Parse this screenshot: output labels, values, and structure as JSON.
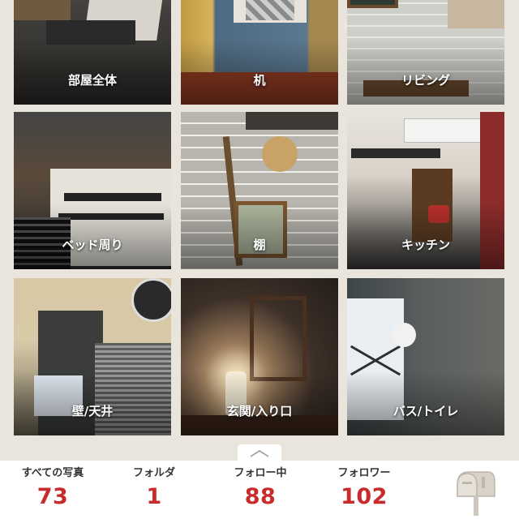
{
  "folders": [
    {
      "label": "部屋全体",
      "icon": "room-photo"
    },
    {
      "label": "机",
      "icon": "desk-photo"
    },
    {
      "label": "リビング",
      "icon": "living-photo"
    },
    {
      "label": "ベッド周り",
      "icon": "bed-photo"
    },
    {
      "label": "棚",
      "icon": "shelf-photo"
    },
    {
      "label": "キッチン",
      "icon": "kitchen-photo"
    },
    {
      "label": "壁/天井",
      "icon": "wall-photo"
    },
    {
      "label": "玄関/入り口",
      "icon": "entrance-photo"
    },
    {
      "label": "バス/トイレ",
      "icon": "bath-photo"
    }
  ],
  "stats": {
    "photos": {
      "label": "すべての写真",
      "value": "73"
    },
    "folders": {
      "label": "フォルダ",
      "value": "1"
    },
    "following": {
      "label": "フォロー中",
      "value": "88"
    },
    "followers": {
      "label": "フォロワー",
      "value": "102"
    }
  },
  "icons": {
    "handle": "chevron-up-icon",
    "mail": "mailbox-icon"
  },
  "colors": {
    "accent": "#c72b2b",
    "background": "#e9e4dc"
  }
}
